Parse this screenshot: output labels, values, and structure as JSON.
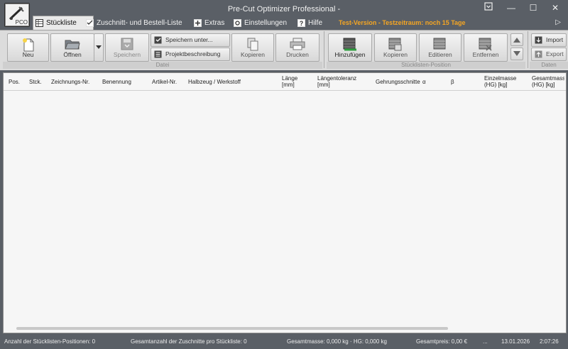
{
  "app": {
    "title": "Pre-Cut Optimizer Professional -",
    "icon_label": "PCO"
  },
  "window_controls": {
    "menu_icon": "dropdown-box-icon",
    "minimize": "—",
    "maximize": "☐",
    "close": "✕"
  },
  "tabs": [
    {
      "label": "Stückliste",
      "icon": "table-icon",
      "active": true
    },
    {
      "label": "Zuschnitt- und Bestell-Liste",
      "icon": "checklist-icon",
      "active": false
    },
    {
      "label": "Extras",
      "icon": "plus-icon",
      "active": false
    },
    {
      "label": "Einstellungen",
      "icon": "settings-icon",
      "active": false
    },
    {
      "label": "Hilfe",
      "icon": "help-icon",
      "active": false
    }
  ],
  "trial_notice": "Test-Version - Testzeitraum: noch 15 Tage",
  "ribbon": {
    "datei": {
      "group_label": "Datei",
      "neu": "Neu",
      "oeffnen": "Öffnen",
      "speichern": "Speichern",
      "speichern_unter": "Speichern unter...",
      "projektbeschreibung": "Projektbeschreibung",
      "kopieren": "Kopieren",
      "drucken": "Drucken"
    },
    "position": {
      "group_label": "Stücklisten-Position",
      "hinzufuegen": "Hinzufügen",
      "kopieren": "Kopieren",
      "editieren": "Editieren",
      "entfernen": "Entfernen"
    },
    "daten": {
      "group_label": "Daten",
      "import": "Import",
      "export": "Export"
    }
  },
  "table": {
    "columns": [
      "Pos.",
      "Stck.",
      "Zeichnungs-Nr.",
      "Benennung",
      "Artikel-Nr.",
      "Halbzeug / Werkstoff",
      "Länge [mm]",
      "Längentoleranz [mm]",
      "Gehrungsschnitte",
      "α",
      "β",
      "Einzelmasse (HG) [kg]",
      "Gesamtmasse (HG) [kg]"
    ],
    "rows": []
  },
  "status": {
    "positions": "Anzahl der Stücklisten-Positionen:  0",
    "cuts": "Gesamtanzahl der Zuschnitte pro Stückliste:  0",
    "mass": "Gesamtmasse:  0,000 kg  · HG:  0,000 kg",
    "price": "Gesamtpreis:  0,00 €",
    "ellipsis": "...",
    "date": "13.01.2026",
    "time": "2:07:26"
  },
  "colors": {
    "chrome": "#5a5f66",
    "ribbon": "#dcdcdc",
    "trial": "#f5a623",
    "table_bg": "#f6f6f6"
  }
}
